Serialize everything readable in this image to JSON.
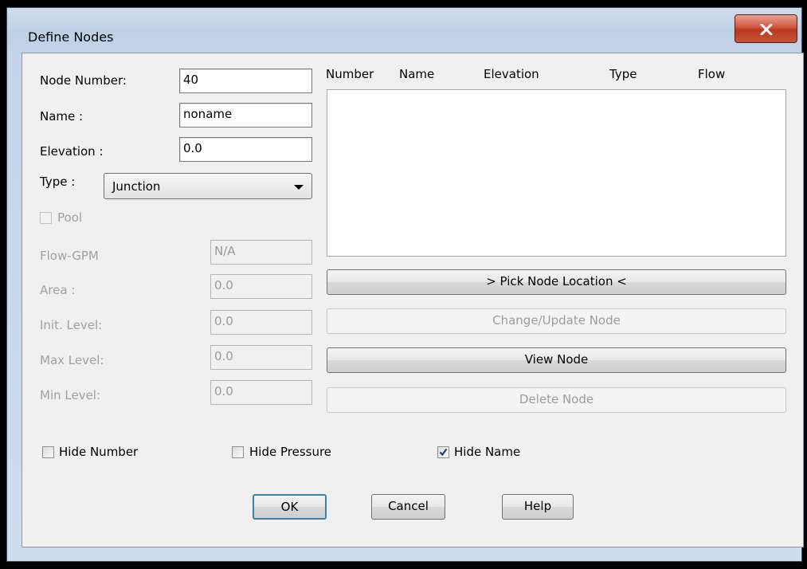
{
  "window": {
    "title": "Define Nodes",
    "close_glyph": "x"
  },
  "form": {
    "node_number": {
      "label": "Node Number:",
      "value": "40"
    },
    "name": {
      "label": "Name   :",
      "value": "noname"
    },
    "elevation": {
      "label": "Elevation  :",
      "value": "0.0"
    },
    "type": {
      "label": "Type :",
      "value": "Junction"
    },
    "pool": {
      "label": "Pool",
      "checked": false,
      "enabled": false
    },
    "flow": {
      "label": "Flow-GPM",
      "value": "N/A"
    },
    "area": {
      "label": "Area :",
      "value": "0.0"
    },
    "init_level": {
      "label": "Init. Level:",
      "value": "0.0"
    },
    "max_level": {
      "label": "Max Level:",
      "value": "0.0"
    },
    "min_level": {
      "label": "Min Level:",
      "value": "0.0"
    }
  },
  "list": {
    "columns": [
      "Number",
      "Name",
      "Elevation",
      "Type",
      "Flow"
    ],
    "rows": []
  },
  "actions": {
    "pick_location": "> Pick Node Location <",
    "change_update": "Change/Update Node",
    "view_node": "View Node",
    "delete_node": "Delete Node"
  },
  "options": {
    "hide_number": {
      "label": "Hide Number",
      "checked": false
    },
    "hide_pressure": {
      "label": "Hide Pressure",
      "checked": false
    },
    "hide_name": {
      "label": "Hide Name",
      "checked": true
    }
  },
  "footer": {
    "ok": "OK",
    "cancel": "Cancel",
    "help": "Help"
  },
  "colors": {
    "title_bar": "#bdd0e6",
    "close_button": "#c6533a",
    "dialog_bg": "#f0f0f0",
    "focus_border": "#3c7fb1"
  }
}
